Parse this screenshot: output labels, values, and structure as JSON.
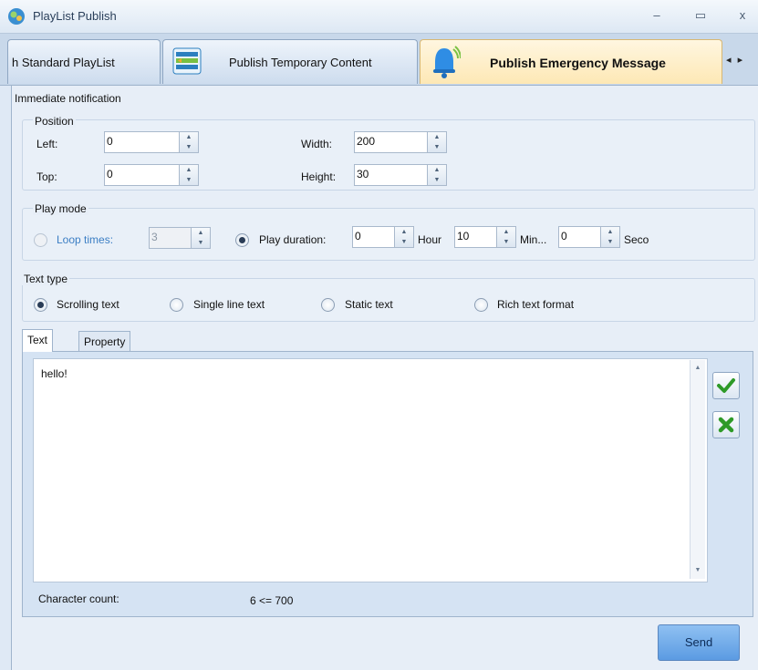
{
  "window": {
    "title": "PlayList Publish",
    "controls": {
      "minimize": "–",
      "maximize": "▭",
      "close": "x"
    }
  },
  "tabs": [
    {
      "label": "h Standard PlayList",
      "icon": ""
    },
    {
      "label": "Publish Temporary Content",
      "icon": "temporary-content-icon"
    },
    {
      "label": "Publish Emergency Message",
      "icon": "bell-icon",
      "active": true
    }
  ],
  "tab_scroll": "◂ ▸",
  "immediate_notification": {
    "label": "Immediate notification"
  },
  "position": {
    "label": "Position",
    "left": {
      "label": "Left:",
      "value": "0"
    },
    "top": {
      "label": "Top:",
      "value": "0"
    },
    "width": {
      "label": "Width:",
      "value": "200"
    },
    "height": {
      "label": "Height:",
      "value": "30"
    }
  },
  "play_mode": {
    "label": "Play mode",
    "loop_times": {
      "label": "Loop times:",
      "value": "3"
    },
    "play_duration": {
      "label": "Play duration:",
      "hours": "0",
      "hour_unit": "Hour",
      "minutes": "10",
      "minute_unit": "Min...",
      "seconds": "0",
      "second_unit": "Seco"
    }
  },
  "text_type": {
    "label": "Text type",
    "options": [
      "Scrolling text",
      "Single line text",
      "Static text",
      "Rich text format"
    ],
    "selected": "Scrolling text"
  },
  "inner_tabs": [
    "Text",
    "Property"
  ],
  "editor": {
    "content": "hello!",
    "character_count_label": "Character count:",
    "character_count_value": "6 <= 700"
  },
  "actions": {
    "send": "Send"
  },
  "colors": {
    "accent": "#5b9be2",
    "active_tab": "#fde8b5",
    "confirm": "#2e9a28",
    "cancel": "#2e9a28"
  }
}
